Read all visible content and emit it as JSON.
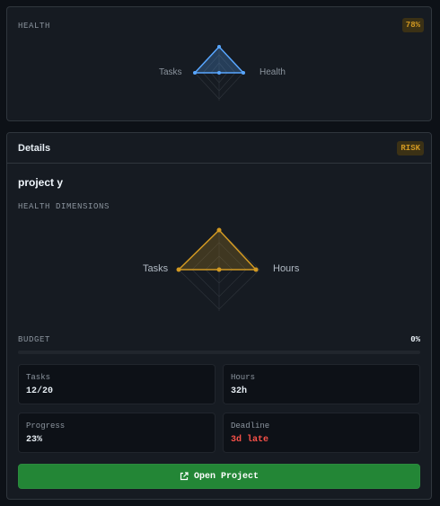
{
  "health_card": {
    "label": "HEALTH",
    "percent_badge": "78%",
    "radar_axes": [
      "Tasks",
      "Health"
    ]
  },
  "details": {
    "header_title": "Details",
    "risk_badge": "RISK",
    "project_name": "project y",
    "dimensions_label": "HEALTH DIMENSIONS",
    "radar_axes": [
      "Tasks",
      "Hours"
    ],
    "budget_label": "BUDGET",
    "budget_value": "0%",
    "budget_fraction": 0,
    "stats": [
      {
        "label": "Tasks",
        "value": "12/20"
      },
      {
        "label": "Hours",
        "value": "32h"
      },
      {
        "label": "Progress",
        "value": "23%"
      },
      {
        "label": "Deadline",
        "value": "3d late"
      }
    ],
    "open_button_label": "Open Project",
    "open_button_icon": "external-link-icon"
  },
  "colors": {
    "health_radar": "#58a6ff",
    "dimensions_radar": "#d29922",
    "badge": "#d29922",
    "late": "#f85149",
    "button": "#238636"
  }
}
